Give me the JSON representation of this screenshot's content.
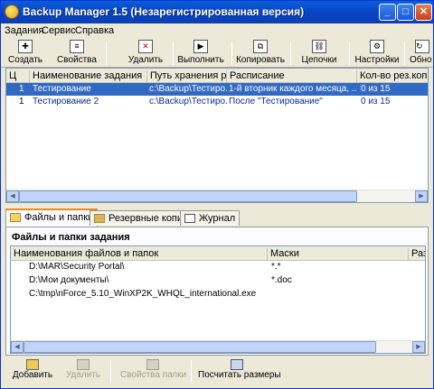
{
  "window": {
    "title": "Backup Manager 1.5  (Незарегистрированная версия)"
  },
  "menu": [
    "Задания",
    "Сервис",
    "Справка"
  ],
  "toolbar": [
    {
      "label": "Создать",
      "icon": "create-icon"
    },
    {
      "label": "Свойства",
      "icon": "properties-icon"
    },
    {
      "label": "Удалить",
      "icon": "delete-icon"
    },
    {
      "label": "Выполнить",
      "icon": "run-icon"
    },
    {
      "label": "Копировать",
      "icon": "copy-icon"
    },
    {
      "label": "Цепочки",
      "icon": "chains-icon"
    },
    {
      "label": "Настройки",
      "icon": "settings-icon"
    },
    {
      "label": "Обно",
      "icon": "update-icon"
    }
  ],
  "jobs": {
    "columns": [
      "Ц",
      "Наименование задания",
      "Путь хранения р...",
      "Расписание",
      "Кол-во рез.копий"
    ],
    "rows": [
      {
        "num": "1",
        "name": "Тестирование",
        "path": "c:\\Backup\\Тестиро...",
        "schedule": "1-й вторник каждого месяца, ...",
        "copies": "0 из 15"
      },
      {
        "num": "1",
        "name": "Тестирование 2",
        "path": "c:\\Backup\\Тестиро...",
        "schedule": "После \"Тестирование\"",
        "copies": "0 из 15"
      }
    ]
  },
  "tabs": [
    "Файлы и папки",
    "Резервные копии",
    "Журнал"
  ],
  "files": {
    "title": "Файлы и папки задания",
    "columns": [
      "Наименования файлов и папок",
      "Маски",
      "Разме"
    ],
    "rows": [
      {
        "name": "D:\\MAR\\Security Portal\\",
        "mask": "*.*",
        "type": "folder"
      },
      {
        "name": "D:\\Мои документы\\",
        "mask": "*.doc",
        "type": "folder"
      },
      {
        "name": "C:\\tmp\\nForce_5.10_WinXP2K_WHQL_international.exe",
        "mask": "",
        "type": "file"
      }
    ]
  },
  "bottom": {
    "add": "Добавить",
    "delete": "Удалить",
    "props": "Свойства папки",
    "calc": "Посчитать размеры"
  }
}
